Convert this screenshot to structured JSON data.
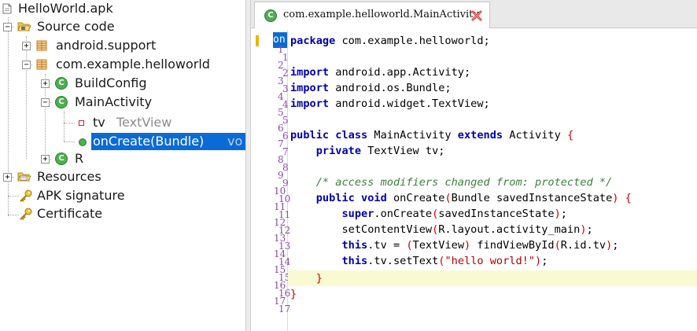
{
  "tree": {
    "root": "HelloWorld.apk",
    "source_code": "Source code",
    "pkg_support": "android.support",
    "pkg_main": "com.example.helloworld",
    "cls_buildconfig": "BuildConfig",
    "cls_mainactivity": "MainActivity",
    "field_tv_name": "tv",
    "field_tv_type": "TextView",
    "method_oncreate": "onCreate(Bundle)",
    "method_oncreate_ret": "vo",
    "cls_r": "R",
    "resources": "Resources",
    "apk_signature": "APK signature",
    "certificate": "Certificate"
  },
  "icons": {
    "class_letter": "C",
    "expanded": "−",
    "collapsed": "+"
  },
  "editor": {
    "tab_title": "com.example.helloworld.MainActivity",
    "overlap_label": "on",
    "line_numbers_a": [
      "1",
      "2",
      "3",
      "4",
      "5",
      "6",
      "7",
      "8",
      "9",
      "10",
      "11",
      "12",
      "13",
      "14",
      "15",
      "16",
      "17"
    ],
    "line_numbers_b": [
      "1",
      "2",
      "3",
      "4",
      "5",
      "6",
      "7",
      "8",
      "9",
      "10",
      "11",
      "12",
      "13",
      "14",
      "15",
      "16",
      "17"
    ]
  },
  "code": {
    "l1_kw": "package",
    "l1_rest": " com.example.helloworld;",
    "l3_kw": "import",
    "l3_rest": " android.app.Activity;",
    "l4_kw": "import",
    "l4_rest": " android.os.Bundle;",
    "l5_kw": "import",
    "l5_rest": " android.widget.TextView;",
    "l7_kw1": "public",
    "l7_kw2": "class",
    "l7_name": " MainActivity ",
    "l7_kw3": "extends",
    "l7_rest": " Activity ",
    "l7_brace": "{",
    "l8_indent": "    ",
    "l8_kw": "private",
    "l8_rest": " TextView tv;",
    "l10_indent": "    ",
    "l10_comment": "/* access modifiers changed from: protected */",
    "l11_indent": "    ",
    "l11_kw1": "public",
    "l11_kw2": "void",
    "l11_name": " onCreate",
    "l11_p1": "(",
    "l11_params": "Bundle savedInstanceState",
    "l11_p2": ")",
    "l11_sp": " ",
    "l11_brace": "{",
    "l12_indent": "        ",
    "l12_kw": "super",
    "l12_m": ".onCreate",
    "l12_p1": "(",
    "l12_arg": "savedInstanceState",
    "l12_p2": ")",
    "l12_end": ";",
    "l13_indent": "        ",
    "l13_m": "setContentView",
    "l13_p1": "(",
    "l13_arg": "R.layout.activity_main",
    "l13_p2": ")",
    "l13_end": ";",
    "l14_indent": "        ",
    "l14_kw": "this",
    "l14_a": ".tv = ",
    "l14_p1": "(",
    "l14_cast": "TextView",
    "l14_p2": ")",
    "l14_b": " findViewById",
    "l14_p3": "(",
    "l14_arg": "R.id.tv",
    "l14_p4": ")",
    "l14_end": ";",
    "l15_indent": "        ",
    "l15_kw": "this",
    "l15_m": ".tv.setText",
    "l15_p1": "(",
    "l15_str": "\"hello world!\"",
    "l15_p2": ")",
    "l15_end": ";",
    "l16_indent": "    ",
    "l16_brace": "}",
    "l17_brace": "}"
  }
}
